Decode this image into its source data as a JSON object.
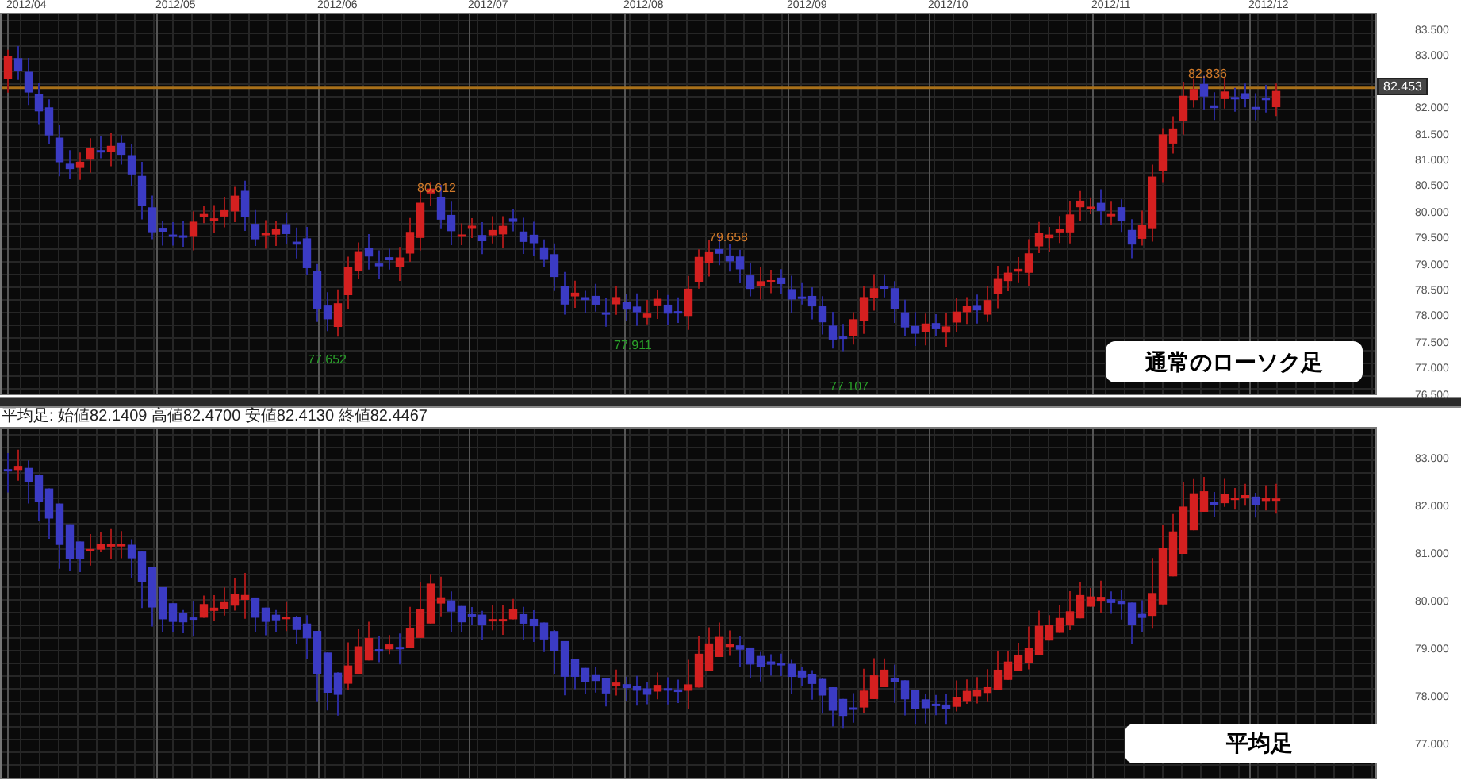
{
  "top_panel": {
    "months": [
      "2012/04",
      "2012/05",
      "2012/06",
      "2012/07",
      "2012/08",
      "2012/09",
      "2012/10",
      "2012/11",
      "2012/12"
    ],
    "axis_ticks": [
      "83.500",
      "83.000",
      "82.000",
      "81.500",
      "81.000",
      "80.500",
      "80.000",
      "79.500",
      "79.000",
      "78.500",
      "78.000",
      "77.500",
      "77.000",
      "76.500"
    ],
    "current_price": "82.453",
    "annotations": [
      {
        "label": "80.612",
        "kind": "high"
      },
      {
        "label": "79.658",
        "kind": "high"
      },
      {
        "label": "82.836",
        "kind": "high"
      },
      {
        "label": "77.652",
        "kind": "low"
      },
      {
        "label": "77.911",
        "kind": "low"
      },
      {
        "label": "77.107",
        "kind": "low"
      }
    ],
    "caption": "通常のローソク足"
  },
  "info_line": "平均足: 始値82.1409 高値82.4700 安値82.4130 終値82.4467",
  "bottom_panel": {
    "axis_ticks": [
      "83.000",
      "82.000",
      "81.000",
      "80.000",
      "79.000",
      "78.000",
      "77.000"
    ],
    "caption": "平均足"
  }
}
